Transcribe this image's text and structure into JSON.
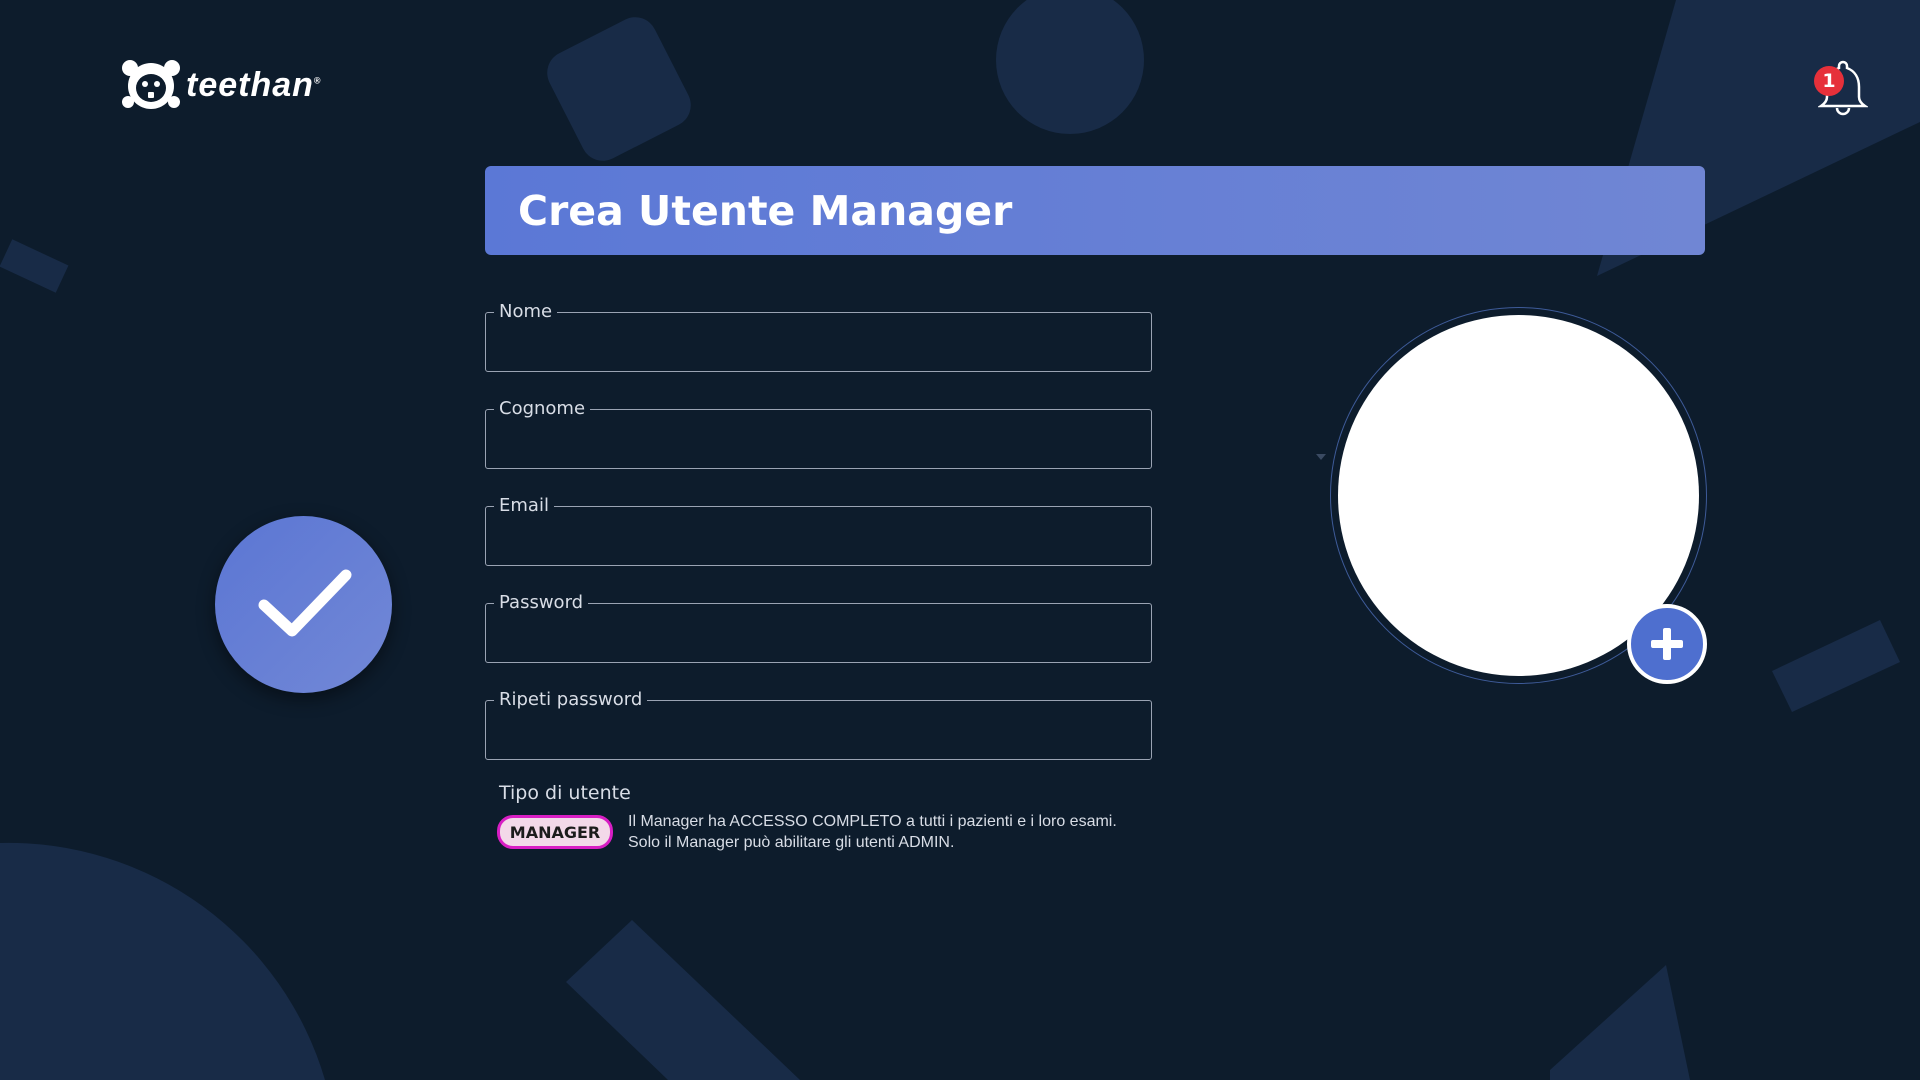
{
  "brand": {
    "name": "teethan",
    "mark": "®"
  },
  "notifications": {
    "count": "1",
    "icon": "bell-icon"
  },
  "page": {
    "title": "Crea Utente Manager"
  },
  "form": {
    "fields": [
      {
        "label": "Nome",
        "value": ""
      },
      {
        "label": "Cognome",
        "value": ""
      },
      {
        "label": "Email",
        "value": ""
      },
      {
        "label": "Password",
        "value": ""
      },
      {
        "label": "Ripeti password",
        "value": ""
      }
    ],
    "user_type": {
      "label": "Tipo di utente",
      "selected": "MANAGER",
      "description_line1": "Il Manager ha ACCESSO COMPLETO a tutti i pazienti e i loro esami.",
      "description_line2": "Solo il Manager può abilitare gli utenti ADMIN."
    }
  },
  "actions": {
    "confirm_icon": "checkmark-icon",
    "add_photo_icon": "plus-icon"
  },
  "colors": {
    "background": "#0d1c2c",
    "accent": "#5b78d6",
    "badge": "#e6303a",
    "chip_border": "#d81ec4"
  }
}
